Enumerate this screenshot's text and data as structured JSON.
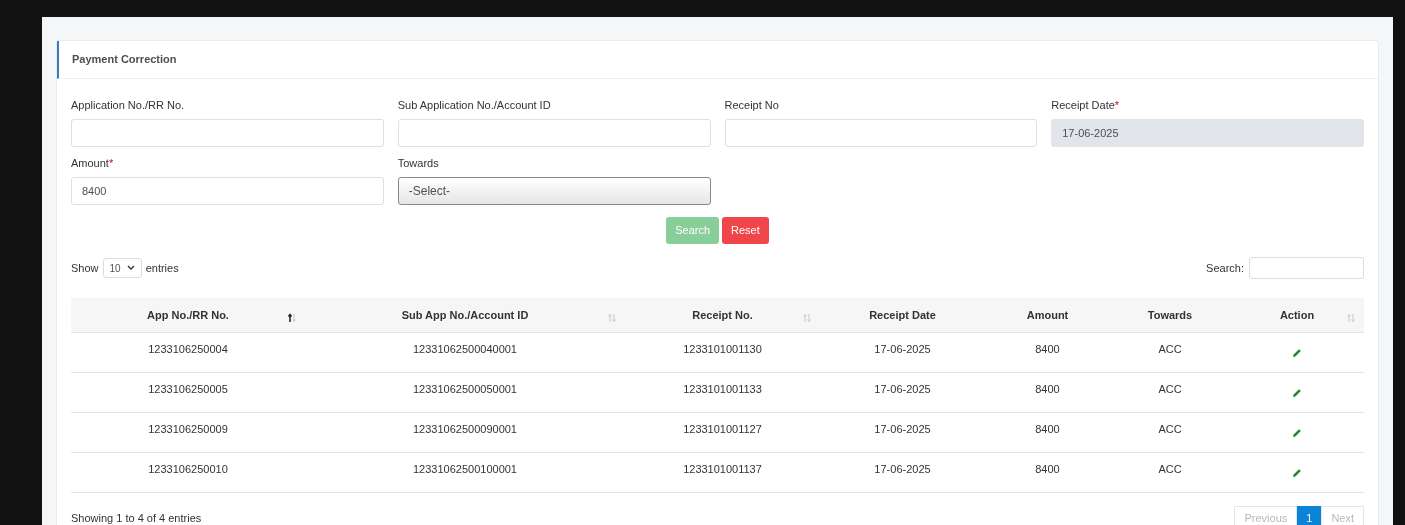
{
  "card": {
    "title": "Payment Correction"
  },
  "fields": [
    {
      "label": "Application No./RR No.",
      "kind": "text",
      "disabled": false
    },
    {
      "label": "Sub Application No./Account ID",
      "kind": "text",
      "disabled": false
    },
    {
      "label": "Receipt No",
      "kind": "text",
      "disabled": false
    },
    {
      "label": "Receipt Date",
      "required_mark": "*",
      "kind": "text",
      "disabled": true,
      "value": "17-06-2025"
    },
    {
      "label": "Amount",
      "required_mark": "*",
      "kind": "text",
      "disabled": false,
      "value": "8400"
    },
    {
      "label": "Towards",
      "kind": "select",
      "disabled": false,
      "value": "-Select-"
    }
  ],
  "buttons": [
    {
      "label": "Search",
      "kind": "success",
      "disabled": true
    },
    {
      "label": "Reset",
      "kind": "danger",
      "disabled": false
    }
  ],
  "length": {
    "before": "Show",
    "value": "10",
    "after": "entries"
  },
  "search": {
    "label": "Search:"
  },
  "table": {
    "columns": [
      {
        "label": "App No./RR No.",
        "sortable": true,
        "sorted": true
      },
      {
        "label": "Sub App No./Account ID",
        "sortable": true,
        "sorted": false
      },
      {
        "label": "Receipt No.",
        "sortable": true,
        "sorted": false
      },
      {
        "label": "Receipt Date",
        "sortable": false
      },
      {
        "label": "Amount",
        "sortable": false
      },
      {
        "label": "Towards",
        "sortable": false
      },
      {
        "label": "Action",
        "sortable": true,
        "sorted": false
      }
    ],
    "rows": [
      [
        "1233106250004",
        "12331062500040001",
        "1233101001130",
        "17-06-2025",
        "8400",
        "ACC"
      ],
      [
        "1233106250005",
        "12331062500050001",
        "1233101001133",
        "17-06-2025",
        "8400",
        "ACC"
      ],
      [
        "1233106250009",
        "12331062500090001",
        "1233101001127",
        "17-06-2025",
        "8400",
        "ACC"
      ],
      [
        "1233106250010",
        "12331062500100001",
        "1233101001137",
        "17-06-2025",
        "8400",
        "ACC"
      ]
    ]
  },
  "info": "Showing 1 to 4 of 4 entries",
  "pagination": [
    {
      "label": "Previous",
      "kind": "nav",
      "disabled": true,
      "selected": false
    },
    {
      "label": "1",
      "kind": "page",
      "disabled": false,
      "selected": true
    },
    {
      "label": "Next",
      "kind": "nav",
      "disabled": true,
      "selected": false
    }
  ]
}
